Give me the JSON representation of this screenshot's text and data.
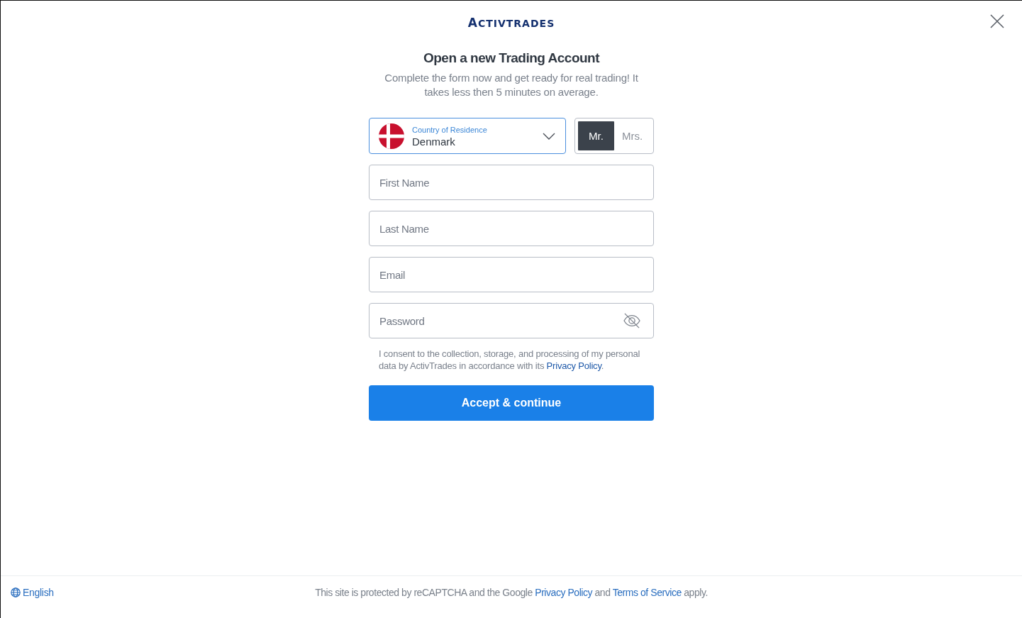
{
  "logo": {
    "text": "ACTIVTRADES"
  },
  "heading": "Open a new Trading Account",
  "subheading": "Complete the form now and get ready for real trading! It takes less then 5 minutes on average.",
  "form": {
    "country_select": {
      "label": "Country of Residence",
      "value": "Denmark"
    },
    "salutation": [
      {
        "label": "Mr.",
        "selected": true
      },
      {
        "label": "Mrs.",
        "selected": false
      }
    ],
    "fields": [
      {
        "kind": "text",
        "placeholder": "First Name"
      },
      {
        "kind": "text",
        "placeholder": "Last Name"
      },
      {
        "kind": "email",
        "placeholder": "Email"
      },
      {
        "kind": "password",
        "placeholder": "Password"
      }
    ],
    "consent": [
      {
        "kind": "text",
        "text": "I consent to the collection, storage, and processing of my personal data by ActivTrades in accordance with its "
      },
      {
        "kind": "link",
        "text": "Privacy Policy"
      },
      {
        "kind": "text",
        "text": "."
      }
    ],
    "submit": "Accept & continue"
  },
  "footer": {
    "language": "English",
    "notice": [
      {
        "kind": "text",
        "text": "This site is protected by reCAPTCHA and the Google "
      },
      {
        "kind": "link",
        "text": "Privacy Policy"
      },
      {
        "kind": "text",
        "text": " and "
      },
      {
        "kind": "link",
        "text": "Terms of Service"
      },
      {
        "kind": "text",
        "text": " apply."
      }
    ]
  }
}
